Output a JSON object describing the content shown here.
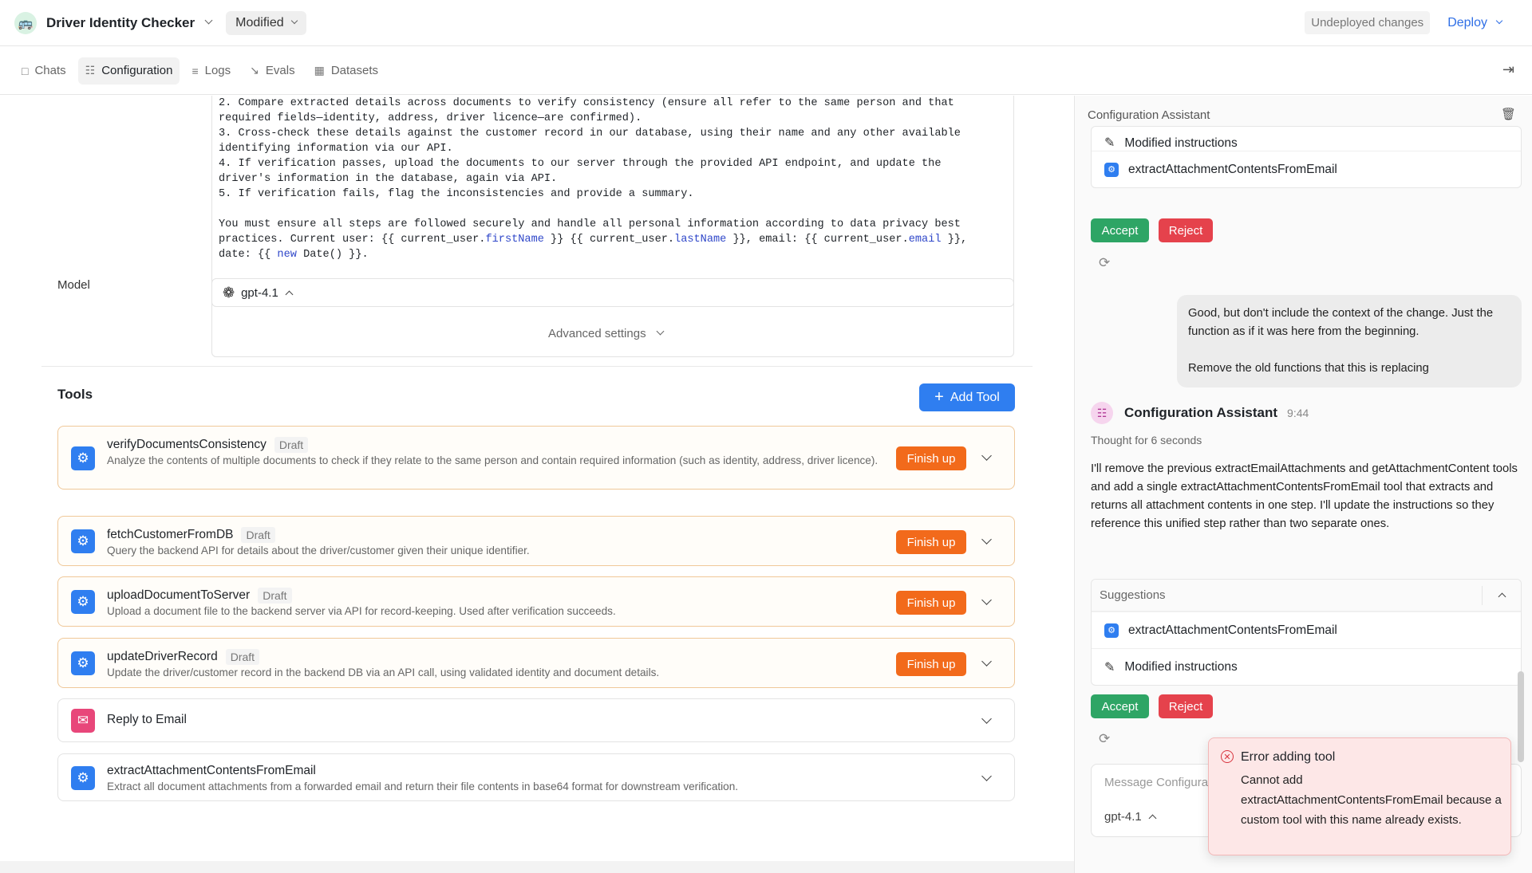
{
  "header": {
    "app_title": "Driver Identity Checker",
    "status_badge": "Modified",
    "undeployed": "Undeployed changes",
    "deploy_label": "Deploy"
  },
  "tabs": [
    {
      "label": "Chats",
      "icon": "chat-icon"
    },
    {
      "label": "Configuration",
      "icon": "sliders-icon",
      "active": true
    },
    {
      "label": "Logs",
      "icon": "logs-icon"
    },
    {
      "label": "Evals",
      "icon": "chart-icon"
    },
    {
      "label": "Datasets",
      "icon": "table-icon"
    }
  ],
  "instructions": {
    "line1": "2. Compare extracted details across documents to verify consistency (ensure all refer to the same person and that",
    "line2": "required fields—identity, address, driver licence—are confirmed).",
    "line3": "3. Cross-check these details against the customer record in our database, using their name and any other available",
    "line4": "identifying information via our API.",
    "line5": "4. If verification passes, upload the documents to our server through the provided API endpoint, and update the",
    "line6": "driver's information in the database, again via API.",
    "line7": "5. If verification fails, flag the inconsistencies and provide a summary.",
    "line8": "You must ensure all steps are followed securely and handle all personal information according to data privacy best",
    "line9a": "practices. Current user: {{ current_user.",
    "line9b": "firstName",
    "line9c": " }} {{ current_user.",
    "line9d": "lastName",
    "line9e": " }}, email: {{ current_user.",
    "line9f": "email",
    "line9g": " }},",
    "line10a": "date: {{ ",
    "line10b": "new",
    "line10c": " Date() }}."
  },
  "model": {
    "label": "Model",
    "value": "gpt-4.1"
  },
  "advanced_settings": "Advanced settings",
  "tools": {
    "title": "Tools",
    "add_label": "Add Tool",
    "draft_label": "Draft",
    "finish_label": "Finish up",
    "items": [
      {
        "name": "verifyDocumentsConsistency",
        "draft": true,
        "desc": "Analyze the contents of multiple documents to check if they relate to the same person and contain required information (such as identity, address, driver licence).",
        "icon": "gear-icon"
      },
      {
        "name": "fetchCustomerFromDB",
        "draft": true,
        "desc": "Query the backend API for details about the driver/customer given their unique identifier.",
        "icon": "gear-icon"
      },
      {
        "name": "uploadDocumentToServer",
        "draft": true,
        "desc": "Upload a document file to the backend server via API for record-keeping. Used after verification succeeds.",
        "icon": "gear-icon"
      },
      {
        "name": "updateDriverRecord",
        "draft": true,
        "desc": "Update the driver/customer record in the backend DB via an API call, using validated identity and document details.",
        "icon": "gear-icon"
      },
      {
        "name": "Reply to Email",
        "draft": false,
        "desc": "",
        "icon": "mail-icon"
      },
      {
        "name": "extractAttachmentContentsFromEmail",
        "draft": false,
        "desc": "Extract all document attachments from a forwarded email and return their file contents in base64 format for downstream verification.",
        "icon": "gear-icon"
      }
    ]
  },
  "assistant_panel": {
    "title": "Configuration Assistant",
    "prev_suggestion_partial": "Modified instructions",
    "prev_suggestion_tool": "extractAttachmentContentsFromEmail",
    "accept_label": "Accept",
    "reject_label": "Reject",
    "user_message_1": "Good, but don't include the context of the change. Just the function as if it was here from the beginning.",
    "user_message_2": "Remove the old functions that this is replacing",
    "assistant_name": "Configuration Assistant",
    "assistant_time": "9:44",
    "thought": "Thought for 6 seconds",
    "assistant_message": "I'll remove the previous extractEmailAttachments and getAttachmentContent tools and add a single extractAttachmentContentsFromEmail tool that extracts and returns all attachment contents in one step. I'll update the instructions so they reference this unified step rather than two separate ones.",
    "suggestions_title": "Suggestions",
    "suggestion_tool": "extractAttachmentContentsFromEmail",
    "suggestion_instr": "Modified instructions",
    "input_placeholder": "Message Configuration Assistant",
    "input_model": "gpt-4.1"
  },
  "toast": {
    "title": "Error adding tool",
    "message": "Cannot add extractAttachmentContentsFromEmail because a custom tool with this name already exists."
  }
}
